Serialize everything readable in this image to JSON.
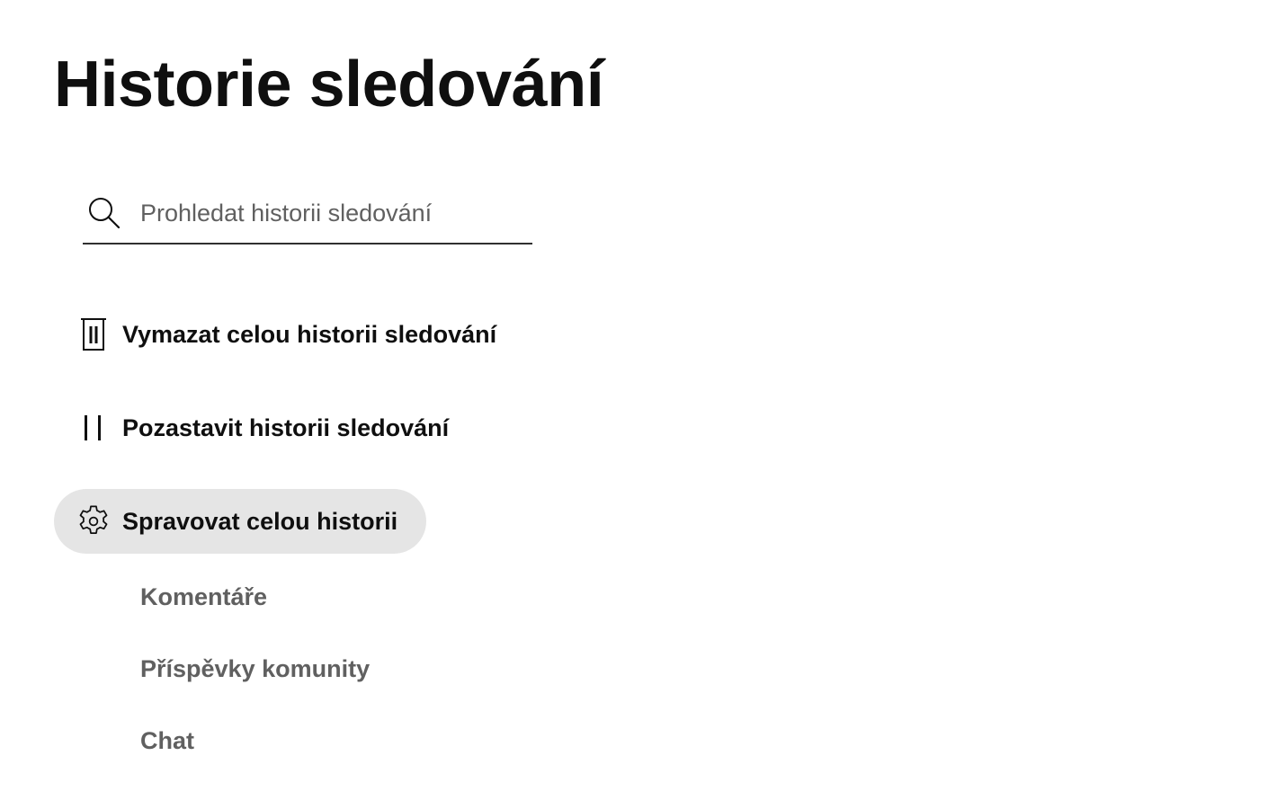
{
  "header": {
    "title": "Historie sledování"
  },
  "search": {
    "placeholder": "Prohledat historii sledování",
    "value": "",
    "icon": "search-icon"
  },
  "actions": [
    {
      "label": "Vymazat celou historii sledování",
      "icon": "trash-icon"
    },
    {
      "label": "Pozastavit historii sledování",
      "icon": "pause-icon"
    },
    {
      "label": "Spravovat celou historii",
      "icon": "gear-icon",
      "selected": true
    }
  ],
  "sub_links": [
    {
      "label": "Komentáře"
    },
    {
      "label": "Příspěvky komunity"
    },
    {
      "label": "Chat"
    }
  ],
  "colors": {
    "text_primary": "#0f0f0f",
    "text_secondary": "#606060",
    "selected_background": "#e5e5e5",
    "search_underline": "#303030",
    "background": "#ffffff"
  }
}
